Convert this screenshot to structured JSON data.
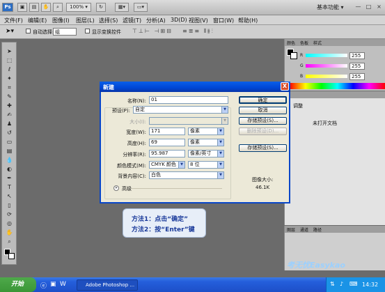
{
  "appbar": {
    "zoom": "100%",
    "workspace": "基本功能",
    "minimize": "—",
    "restore": "□",
    "close": "×"
  },
  "menu": [
    "文件(F)",
    "编辑(E)",
    "图像(I)",
    "图层(L)",
    "选择(S)",
    "滤镜(T)",
    "分析(A)",
    "3D(D)",
    "视图(V)",
    "窗口(W)",
    "帮助(H)"
  ],
  "optbar": {
    "auto_select": "自动选择:",
    "auto_select_value": "组",
    "show_transform": "显示变换控件"
  },
  "color_panel": {
    "tabs": [
      "颜色",
      "色板",
      "样式"
    ],
    "channels": [
      {
        "label": "R",
        "value": "255",
        "color_start": "#00ffff",
        "color_end": "#ffffff"
      },
      {
        "label": "G",
        "value": "255",
        "color_start": "#ff00ff",
        "color_end": "#ffffff"
      },
      {
        "label": "B",
        "value": "255",
        "color_start": "#ffff00",
        "color_end": "#ffffff"
      }
    ]
  },
  "adjust_panel": {
    "title": "调整",
    "empty_text": "未打开文档"
  },
  "layers_panel": {
    "tabs": [
      "图层",
      "通道",
      "路径"
    ]
  },
  "dialog": {
    "title": "新建",
    "close": "X",
    "name_label": "名称(N):",
    "name_value": "01",
    "preset_label": "预设(P):",
    "preset_value": "自定",
    "size_label": "大小(I):",
    "size_value": "",
    "width_label": "宽度(W):",
    "width_value": "171",
    "width_unit": "像素",
    "height_label": "高度(H):",
    "height_value": "69",
    "height_unit": "像素",
    "resolution_label": "分辨率(R):",
    "resolution_value": "95.987",
    "resolution_unit": "像素/英寸",
    "mode_label": "颜色模式(M):",
    "mode_value": "CMYK 颜色",
    "bits_value": "8 位",
    "bg_label": "背景内容(C):",
    "bg_value": "白色",
    "advanced_label": "高级",
    "buttons": {
      "ok": "确定",
      "cancel": "取消",
      "save_preset": "存储预设(S)...",
      "delete_preset": "删除预设(D)...",
      "device_central": "存储预设(S)..."
    },
    "image_size_label": "图像大小:",
    "image_size_value": "46.1K"
  },
  "callout": {
    "line1": "方法1：点击“确定”",
    "line2": "方法2：按“Enter”键"
  },
  "taskbar": {
    "start": "开始",
    "task": "Adobe Photoshop ...",
    "clock": "14:32"
  },
  "watermark": "考无忧Easykao"
}
